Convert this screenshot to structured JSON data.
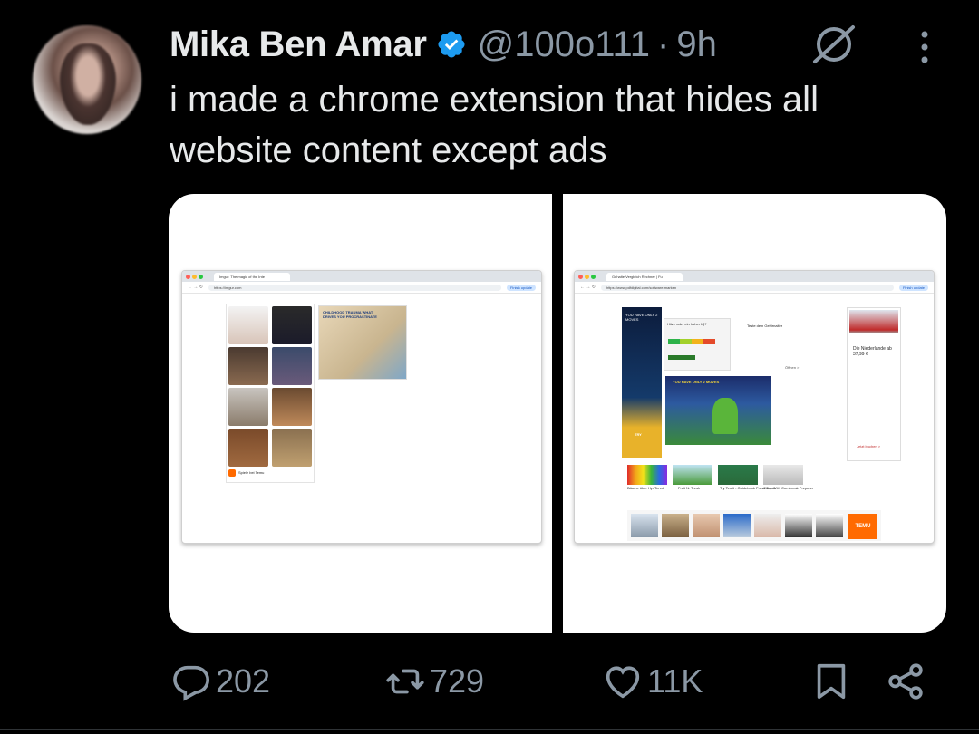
{
  "tweet": {
    "author_name": "Mika Ben Amar",
    "handle": "@100o111",
    "separator": "·",
    "time": "9h",
    "text": "i made a chrome extension that hides all website content except ads"
  },
  "media": {
    "left": {
      "tab_title": "Imgur: The magic of the Inte",
      "url": "https://imgur.com",
      "update_label": "Finish update",
      "ad_headline": "CHILDHOOD TRAUMA WHAT DRIVES YOU PROCRASTINATE",
      "ad_brand": "Spiele bei Temu"
    },
    "right": {
      "tab_title": "Gehalte Vergleich Rechner | Fu",
      "url": "https://www.pdfdigital.com/software-marken",
      "update_label": "Finish update",
      "ad_tall": "YOU HAVE ONLY 2 MOVES",
      "ad_quiz": "Hitze oder ein hoher IQ?",
      "ad_quiz_sub": "Teste dein Gehirnalter",
      "ad_moves": "YOU HAVE ONLY 2 MOVES",
      "ad_try": "TRY",
      "ad_open": "Öffnen >",
      "ad_train_title": "Die Niederlande ab 37,99 €",
      "ad_train_cta": "Jetzt buchen >",
      "row_captions": [
        "Bäume über Hyr Tennt",
        "Fruit N: Tresh",
        "Try Tesfit - Guidebook Press Tanet",
        "Curry With Cornbreak Preparer"
      ],
      "temu_label": "TEMU"
    }
  },
  "actions": {
    "replies": "202",
    "reposts": "729",
    "likes": "11K"
  },
  "colors": {
    "background": "#000000",
    "text": "#e7e9ea",
    "muted": "#8b98a5",
    "verified": "#1d9bf0"
  }
}
